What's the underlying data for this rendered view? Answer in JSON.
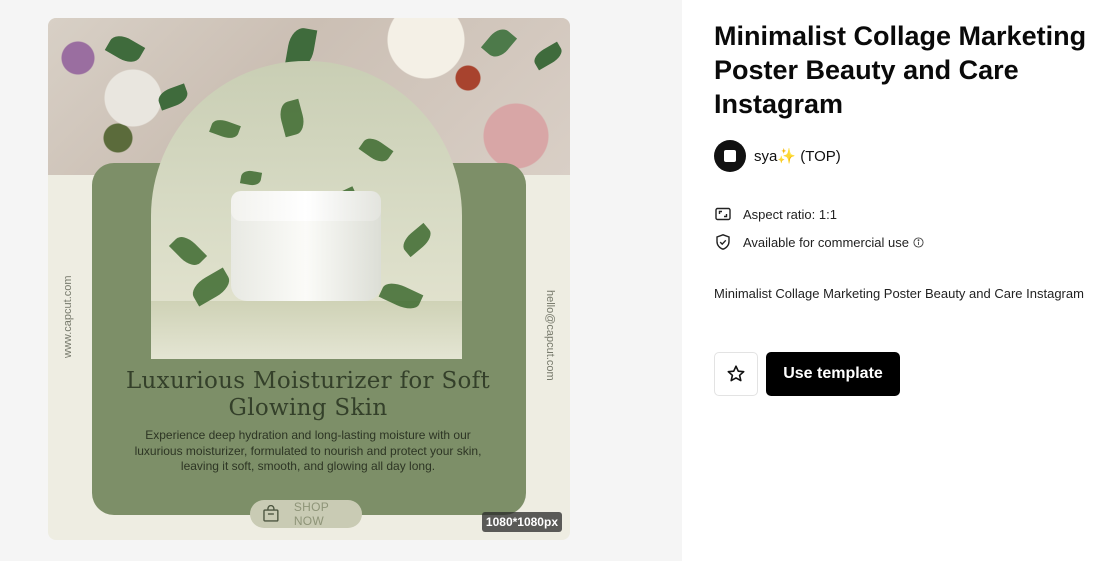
{
  "preview": {
    "headline": "Luxurious Moisturizer for Soft Glowing Skin",
    "body": "Experience deep hydration and long-lasting moisture with our luxurious moisturizer, formulated to nourish and protect your skin, leaving it soft, smooth, and glowing all day long.",
    "website": "www.capcut.com",
    "email": "hello@capcut.com",
    "shop_label": "SHOP NOW",
    "dimensions": "1080*1080px",
    "colors": {
      "panel": "#7d8f68",
      "background": "#eeede2",
      "headline": "#34402a"
    }
  },
  "details": {
    "title": "Minimalist Collage Marketing Poster Beauty and Care Instagram",
    "author": {
      "name": "sya",
      "emoji": "✨",
      "suffix": "(TOP)"
    },
    "aspect_ratio": "Aspect ratio: 1:1",
    "commercial": "Available for commercial use",
    "description": "Minimalist Collage Marketing Poster Beauty and Care Instagram",
    "use_label": "Use template"
  },
  "icons": {
    "aspect": "aspect-ratio-icon",
    "commercial": "shield-check-icon",
    "info": "info-icon",
    "favorite": "star-icon",
    "bag": "shopping-bag-icon"
  }
}
